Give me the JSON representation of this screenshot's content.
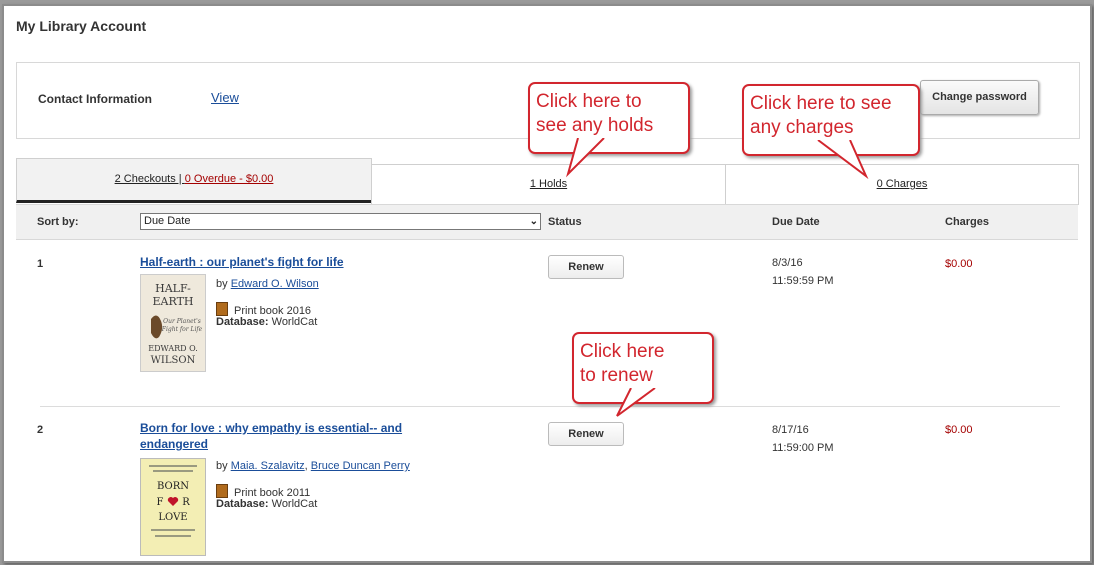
{
  "page_title": "My Library Account",
  "contact": {
    "label": "Contact Information",
    "link": "View",
    "change_password": "Change password"
  },
  "tabs": {
    "checkouts_text": "2 Checkouts | ",
    "overdue_text": "0 Overdue - $0.00",
    "holds": "1 Holds",
    "charges": "0 Charges"
  },
  "table": {
    "sort_label": "Sort by:",
    "sort_value": "Due Date",
    "col_status": "Status",
    "col_due": "Due Date",
    "col_charges": "Charges"
  },
  "items": [
    {
      "num": "1",
      "title": "Half-earth : our planet's fight for life",
      "by": "by ",
      "authors": [
        "Edward O. Wilson"
      ],
      "format": "Print book 2016",
      "database_label": "Database:",
      "database": " WorldCat",
      "renew": "Renew",
      "due_date": "8/3/16",
      "due_time": "11:59:59 PM",
      "charge": "$0.00",
      "cover": {
        "line1": "HALF-",
        "line2": "EARTH",
        "line3": "Our Planet's",
        "line4": "Fight for Life",
        "line5": "EDWARD O.",
        "line6": "WILSON"
      }
    },
    {
      "num": "2",
      "title": "Born for love : why empathy is essential-- and endangered",
      "by": "by ",
      "authors": [
        "Maia. Szalavitz",
        "Bruce Duncan Perry"
      ],
      "format": "Print book 2011",
      "database_label": "Database:",
      "database": " WorldCat",
      "renew": "Renew",
      "due_date": "8/17/16",
      "due_time": "11:59:00 PM",
      "charge": "$0.00",
      "cover": {
        "line1": "BORN",
        "line2": "F",
        "line3": "R",
        "line4": "LOVE"
      }
    }
  ],
  "callouts": {
    "holds": [
      "Click here to",
      "see any holds"
    ],
    "charges": [
      "Click here to see",
      "any charges"
    ],
    "renew": [
      "Click here",
      "to renew"
    ]
  },
  "colors": {
    "link": "#1a4d99",
    "money": "#a40000",
    "callout": "#d2262e"
  }
}
